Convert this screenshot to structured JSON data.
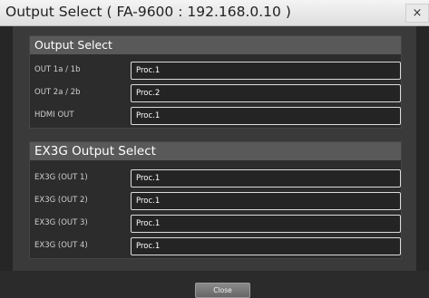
{
  "window": {
    "title": "Output Select ( FA-9600 : 192.168.0.10 )",
    "close_glyph": "×"
  },
  "sections": [
    {
      "header": "Output Select",
      "rows": [
        {
          "label": "OUT 1a / 1b",
          "value": "Proc.1"
        },
        {
          "label": "OUT 2a / 2b",
          "value": "Proc.2"
        },
        {
          "label": "HDMI OUT",
          "value": "Proc.1"
        }
      ]
    },
    {
      "header": "EX3G Output Select",
      "rows": [
        {
          "label": "EX3G (OUT 1)",
          "value": "Proc.1"
        },
        {
          "label": "EX3G (OUT 2)",
          "value": "Proc.1"
        },
        {
          "label": "EX3G (OUT 3)",
          "value": "Proc.1"
        },
        {
          "label": "EX3G (OUT 4)",
          "value": "Proc.1"
        }
      ]
    }
  ],
  "footer": {
    "close_label": "Close"
  }
}
